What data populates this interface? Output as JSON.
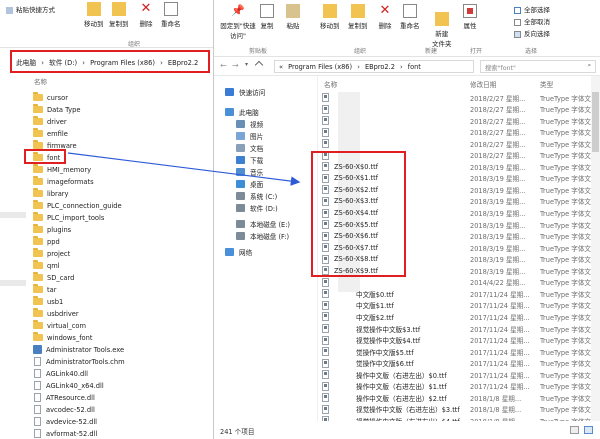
{
  "left": {
    "ribbon": {
      "paste_shortcut": "粘贴快捷方式",
      "move_to": "移动到",
      "copy_to": "复制到",
      "delete": "删除",
      "rename": "重命名",
      "organize": "组织"
    },
    "address": [
      "此电脑",
      "›",
      "软件 (D:)",
      "›",
      "Program Files (x86)",
      "›",
      "EBpro2.2"
    ],
    "column_name": "名称",
    "items": [
      {
        "name": "cursor",
        "type": "folder"
      },
      {
        "name": "Data Type",
        "type": "folder"
      },
      {
        "name": "driver",
        "type": "folder"
      },
      {
        "name": "emfile",
        "type": "folder"
      },
      {
        "name": "firmware",
        "type": "folder"
      },
      {
        "name": "font",
        "type": "folder"
      },
      {
        "name": "HMI_memory",
        "type": "folder"
      },
      {
        "name": "imageformats",
        "type": "folder"
      },
      {
        "name": "library",
        "type": "folder"
      },
      {
        "name": "PLC_connection_guide",
        "type": "folder"
      },
      {
        "name": "PLC_import_tools",
        "type": "folder"
      },
      {
        "name": "plugins",
        "type": "folder"
      },
      {
        "name": "ppd",
        "type": "folder"
      },
      {
        "name": "project",
        "type": "folder"
      },
      {
        "name": "qml",
        "type": "folder"
      },
      {
        "name": "SD_card",
        "type": "folder"
      },
      {
        "name": "tar",
        "type": "folder"
      },
      {
        "name": "usb1",
        "type": "folder"
      },
      {
        "name": "usbdriver",
        "type": "folder"
      },
      {
        "name": "virtual_com",
        "type": "folder"
      },
      {
        "name": "windows_font",
        "type": "folder"
      },
      {
        "name": "Administrator Tools.exe",
        "type": "exe"
      },
      {
        "name": "AdministratorTools.chm",
        "type": "file"
      },
      {
        "name": "AGLink40.dll",
        "type": "file"
      },
      {
        "name": "AGLink40_x64.dll",
        "type": "file"
      },
      {
        "name": "ATResource.dll",
        "type": "file"
      },
      {
        "name": "avcodec-52.dll",
        "type": "file"
      },
      {
        "name": "avdevice-52.dll",
        "type": "file"
      },
      {
        "name": "avformat-52.dll",
        "type": "file"
      }
    ]
  },
  "right": {
    "ribbon": {
      "pin": "固定到\"快速访问\"",
      "copy": "复制",
      "paste": "粘贴",
      "move_to": "移动到",
      "copy_to": "复制到",
      "delete": "删除",
      "rename": "重命名",
      "new_folder": "新建\n文件夹",
      "properties": "属性",
      "select_all": "全部选择",
      "select_none": "全部取消",
      "invert": "反向选择",
      "grp_clipboard": "剪贴板",
      "grp_organize": "组织",
      "grp_new": "新建",
      "grp_open": "打开",
      "grp_select": "选择"
    },
    "address": [
      "«",
      "Program Files (x86)",
      "›",
      "EBpro2.2",
      "›",
      "font"
    ],
    "search_placeholder": "搜索\"font\"",
    "nav": [
      {
        "label": "快速访问",
        "icon": "star-icon",
        "color": "#3a7bd5"
      },
      {
        "label": "此电脑",
        "icon": "computer-icon",
        "color": "#4a8fd8"
      },
      {
        "label": "视频",
        "icon": "video-icon",
        "color": "#6a8fb5"
      },
      {
        "label": "图片",
        "icon": "picture-icon",
        "color": "#7aa6d6"
      },
      {
        "label": "文档",
        "icon": "document-icon",
        "color": "#8aa0b8"
      },
      {
        "label": "下载",
        "icon": "download-icon",
        "color": "#3d7fd0"
      },
      {
        "label": "音乐",
        "icon": "music-icon",
        "color": "#4f8fd0"
      },
      {
        "label": "桌面",
        "icon": "desktop-icon",
        "color": "#3c8fd6"
      },
      {
        "label": "系统 (C:)",
        "icon": "drive-icon",
        "color": "#7d8b99"
      },
      {
        "label": "软件 (D:)",
        "icon": "drive-icon",
        "color": "#7d8b99"
      },
      {
        "label": "本地磁盘 (E:)",
        "icon": "drive-icon",
        "color": "#7d8b99"
      },
      {
        "label": "本地磁盘 (F:)",
        "icon": "drive-icon",
        "color": "#7d8b99"
      },
      {
        "label": "网络",
        "icon": "network-icon",
        "color": "#4a8fd8"
      }
    ],
    "columns": {
      "name": "名称",
      "date": "修改日期",
      "type": "类型"
    },
    "rows": [
      {
        "name": "",
        "date": "2018/2/27 星期...",
        "type": "TrueType 字体文件"
      },
      {
        "name": "",
        "date": "2018/2/27 星期...",
        "type": "TrueType 字体文件"
      },
      {
        "name": "",
        "date": "2018/2/27 星期...",
        "type": "TrueType 字体文件"
      },
      {
        "name": "",
        "date": "2018/2/27 星期...",
        "type": "TrueType 字体文件"
      },
      {
        "name": "",
        "date": "2018/2/27 星期...",
        "type": "TrueType 字体文件"
      },
      {
        "name": "",
        "date": "2018/2/27 星期...",
        "type": "TrueType 字体文件"
      },
      {
        "name": "ZS-60-X$0.ttf",
        "date": "2018/3/19 星期...",
        "type": "TrueType 字体文件"
      },
      {
        "name": "ZS-60-X$1.ttf",
        "date": "2018/3/19 星期...",
        "type": "TrueType 字体文件"
      },
      {
        "name": "ZS-60-X$2.ttf",
        "date": "2018/3/19 星期...",
        "type": "TrueType 字体文件"
      },
      {
        "name": "ZS-60-X$3.ttf",
        "date": "2018/3/19 星期...",
        "type": "TrueType 字体文件"
      },
      {
        "name": "ZS-60-X$4.ttf",
        "date": "2018/3/19 星期...",
        "type": "TrueType 字体文件"
      },
      {
        "name": "ZS-60-X$5.ttf",
        "date": "2018/3/19 星期...",
        "type": "TrueType 字体文件"
      },
      {
        "name": "ZS-60-X$6.ttf",
        "date": "2018/3/19 星期...",
        "type": "TrueType 字体文件"
      },
      {
        "name": "ZS-60-X$7.ttf",
        "date": "2018/3/19 星期...",
        "type": "TrueType 字体文件"
      },
      {
        "name": "ZS-60-X$8.ttf",
        "date": "2018/3/19 星期...",
        "type": "TrueType 字体文件"
      },
      {
        "name": "ZS-60-X$9.ttf",
        "date": "2018/3/19 星期...",
        "type": "TrueType 字体文件"
      },
      {
        "name": "",
        "date": "2014/4/22 星期...",
        "type": "TrueType 字体文件"
      },
      {
        "name": "中文版$0.ttf",
        "date": "2017/11/24 星期...",
        "type": "TrueType 字体文件"
      },
      {
        "name": "中文版$1.ttf",
        "date": "2017/11/24 星期...",
        "type": "TrueType 字体文件"
      },
      {
        "name": "中文版$2.ttf",
        "date": "2017/11/24 星期...",
        "type": "TrueType 字体文件"
      },
      {
        "name": "视觉操作中文版$3.ttf",
        "date": "2017/11/24 星期...",
        "type": "TrueType 字体文件"
      },
      {
        "name": "视觉操作中文版$4.ttf",
        "date": "2017/11/24 星期...",
        "type": "TrueType 字体文件"
      },
      {
        "name": "觉操作中文版$5.ttf",
        "date": "2017/11/24 星期...",
        "type": "TrueType 字体文件"
      },
      {
        "name": "觉操作中文版$6.ttf",
        "date": "2017/11/24 星期...",
        "type": "TrueType 字体文件"
      },
      {
        "name": "操作中文版（右进左出）$0.ttf",
        "date": "2017/11/24 星期...",
        "type": "TrueType 字体文件"
      },
      {
        "name": "操作中文版（右进左出）$1.ttf",
        "date": "2017/11/24 星期...",
        "type": "TrueType 字体文件"
      },
      {
        "name": "操作中文版（右进左出）$2.ttf",
        "date": "2018/1/8 星期...",
        "type": "TrueType 字体文件"
      },
      {
        "name": "视觉操作中文版（右进左出）$3.ttf",
        "date": "2018/1/8 星期...",
        "type": "TrueType 字体文件"
      },
      {
        "name": "视觉操作中文版（右进左出）$4.ttf",
        "date": "2018/1/8 星期...",
        "type": "TrueType 字体文件"
      }
    ],
    "status": "241 个项目"
  }
}
